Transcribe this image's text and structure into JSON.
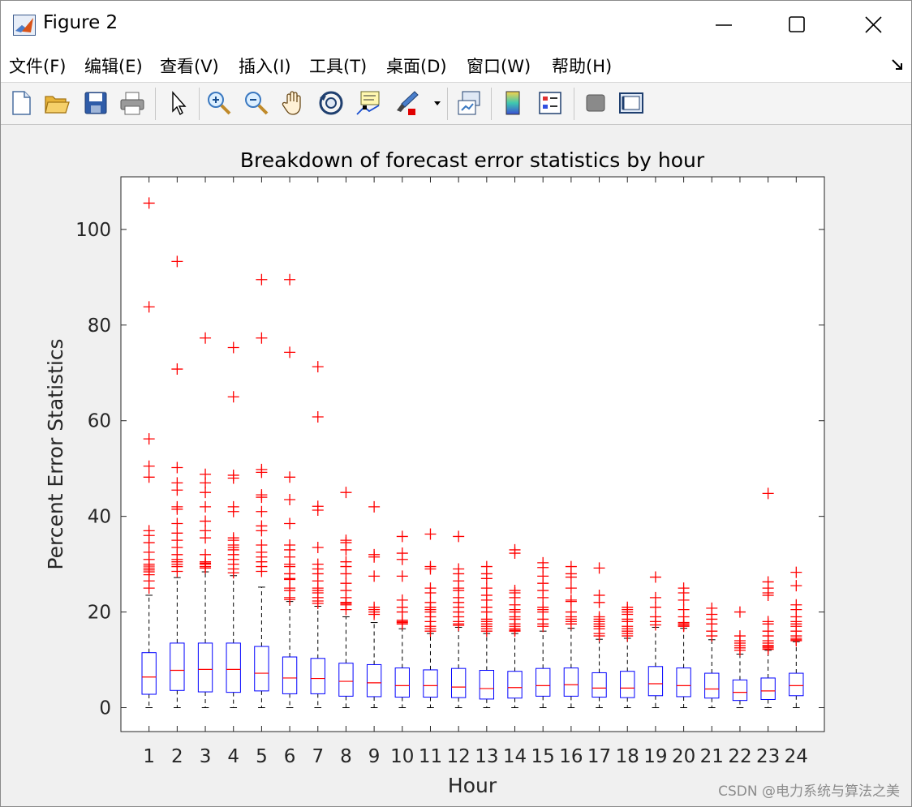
{
  "window": {
    "title": "Figure 2"
  },
  "menu": [
    {
      "label": "文件(F)",
      "key": "F"
    },
    {
      "label": "编辑(E)",
      "key": "E"
    },
    {
      "label": "查看(V)",
      "key": "V"
    },
    {
      "label": "插入(I)",
      "key": "I"
    },
    {
      "label": "工具(T)",
      "key": "T"
    },
    {
      "label": "桌面(D)",
      "key": "D"
    },
    {
      "label": "窗口(W)",
      "key": "W"
    },
    {
      "label": "帮助(H)",
      "key": "H"
    }
  ],
  "toolbar": [
    "new-figure-icon",
    "open-file-icon",
    "save-icon",
    "print-icon",
    "select-arrow-icon",
    "zoom-in-icon",
    "zoom-out-icon",
    "pan-hand-icon",
    "rotate-3d-icon",
    "data-cursor-icon",
    "brush-icon",
    "link-plot-icon",
    "colorbar-icon",
    "legend-icon",
    "hide-plot-tools-icon",
    "show-plot-tools-icon"
  ],
  "watermark": "CSDN @电力系统与算法之美",
  "colors": {
    "box": "#0000ff",
    "median": "#ff0000",
    "outlier": "#ff0000",
    "whisker": "#000000"
  },
  "chart_data": {
    "type": "boxplot",
    "title": "Breakdown of forecast error statistics by hour",
    "xlabel": "Hour",
    "ylabel": "Percent Error Statistics",
    "categories": [
      "1",
      "2",
      "3",
      "4",
      "5",
      "6",
      "7",
      "8",
      "9",
      "10",
      "11",
      "12",
      "13",
      "14",
      "15",
      "16",
      "17",
      "18",
      "19",
      "20",
      "21",
      "22",
      "23",
      "24"
    ],
    "ylim": [
      -5,
      111
    ],
    "yticks": [
      0,
      20,
      40,
      60,
      80,
      100
    ],
    "grid": false,
    "boxes": [
      {
        "q1": 2.8,
        "median": 6.4,
        "q3": 11.5,
        "whisker_low": 0,
        "whisker_high": 23.5,
        "outliers": [
          105.5,
          83.8,
          56.2,
          50.5,
          48.2,
          37,
          36,
          34.5,
          32.5,
          31,
          30,
          29.6,
          29.2,
          28.8,
          28.4,
          27.8,
          26.5,
          25
        ]
      },
      {
        "q1": 3.6,
        "median": 7.8,
        "q3": 13.5,
        "whisker_low": 0,
        "whisker_high": 27.2,
        "outliers": [
          93.3,
          70.8,
          50.2,
          47,
          45.5,
          42,
          41.5,
          38.5,
          36.5,
          35,
          33.5,
          32,
          31,
          30.5,
          30,
          29.5,
          28.5
        ]
      },
      {
        "q1": 3.3,
        "median": 8,
        "q3": 13.5,
        "whisker_low": 0,
        "whisker_high": 28.4,
        "outliers": [
          77.3,
          48.8,
          47,
          45,
          42,
          39,
          37,
          35.5,
          32,
          30.5,
          30.2,
          30,
          29.5,
          29.2
        ]
      },
      {
        "q1": 3.2,
        "median": 8,
        "q3": 13.5,
        "whisker_low": 0,
        "whisker_high": 27.6,
        "outliers": [
          75.3,
          65,
          48.6,
          48,
          42,
          41,
          35.5,
          35,
          34,
          33.5,
          33,
          32,
          31,
          30,
          29,
          28.2
        ]
      },
      {
        "q1": 3.5,
        "median": 7.2,
        "q3": 12.8,
        "whisker_low": 0,
        "whisker_high": 25.2,
        "outliers": [
          89.5,
          77.3,
          49.8,
          49.2,
          44.5,
          44,
          41,
          38,
          37,
          34,
          32.5,
          31.5,
          30.5,
          29.5,
          28.5
        ]
      },
      {
        "q1": 2.9,
        "median": 6.2,
        "q3": 10.6,
        "whisker_low": 0,
        "whisker_high": 22.2,
        "outliers": [
          89.5,
          74.3,
          48.2,
          43.5,
          38.5,
          34,
          33,
          31.5,
          30,
          29.5,
          28,
          27,
          26.8,
          25,
          24.5,
          23,
          22.6
        ]
      },
      {
        "q1": 2.9,
        "median": 6.1,
        "q3": 10.3,
        "whisker_low": 0,
        "whisker_high": 21.2,
        "outliers": [
          71.3,
          60.8,
          42.1,
          41.3,
          33.5,
          30,
          29,
          28,
          26.5,
          25,
          24.5,
          24,
          23,
          22.3,
          21.8
        ]
      },
      {
        "q1": 2.4,
        "median": 5.5,
        "q3": 9.3,
        "whisker_low": 0,
        "whisker_high": 19,
        "outliers": [
          45,
          35,
          34.5,
          33,
          30.5,
          29.5,
          28,
          26,
          24.5,
          23,
          22,
          21.8,
          21.5,
          20.5
        ]
      },
      {
        "q1": 2.3,
        "median": 5.2,
        "q3": 9,
        "whisker_low": 0,
        "whisker_high": 17.8,
        "outliers": [
          42,
          32,
          31.5,
          27.5,
          21,
          20.5,
          20,
          19.5
        ]
      },
      {
        "q1": 2.2,
        "median": 4.6,
        "q3": 8.3,
        "whisker_low": 0,
        "whisker_high": 16.5,
        "outliers": [
          35.8,
          32.3,
          31,
          27.5,
          22.5,
          21,
          20,
          18.3,
          18,
          17.8,
          17.5
        ]
      },
      {
        "q1": 2.2,
        "median": 4.6,
        "q3": 7.9,
        "whisker_low": 0,
        "whisker_high": 15.5,
        "outliers": [
          36.3,
          29.5,
          29,
          25,
          24,
          22,
          21,
          20.5,
          20,
          19,
          18,
          17,
          16.5,
          16
        ]
      },
      {
        "q1": 2.1,
        "median": 4.3,
        "q3": 8.2,
        "whisker_low": 0,
        "whisker_high": 16.8,
        "outliers": [
          35.8,
          29,
          28,
          26.5,
          25,
          24.5,
          23,
          22,
          21,
          20,
          19,
          18,
          17.5,
          17.2
        ]
      },
      {
        "q1": 1.8,
        "median": 4,
        "q3": 7.8,
        "whisker_low": 0,
        "whisker_high": 15.5,
        "outliers": [
          29.5,
          28,
          27,
          25,
          23.5,
          22.5,
          21,
          20,
          18.5,
          18,
          17.5,
          17,
          16.5,
          16
        ]
      },
      {
        "q1": 2,
        "median": 4.2,
        "q3": 7.6,
        "whisker_low": 0,
        "whisker_high": 15.5,
        "outliers": [
          33,
          32.3,
          24.5,
          24,
          23,
          21.5,
          20.5,
          20,
          19,
          18.5,
          17.5,
          17,
          16.5,
          16.2,
          16
        ]
      },
      {
        "q1": 2.4,
        "median": 4.6,
        "q3": 8.2,
        "whisker_low": 0,
        "whisker_high": 16,
        "outliers": [
          30.3,
          29.3,
          27.5,
          26,
          24.5,
          23,
          21,
          20.5,
          20,
          18.5,
          17.5,
          17
        ]
      },
      {
        "q1": 2.4,
        "median": 4.8,
        "q3": 8.3,
        "whisker_low": 0,
        "whisker_high": 16.6,
        "outliers": [
          29.5,
          28,
          27.3,
          25,
          22.5,
          22.2,
          20,
          19,
          18.5,
          18,
          17.5
        ]
      },
      {
        "q1": 2.2,
        "median": 4.1,
        "q3": 7.3,
        "whisker_low": 0,
        "whisker_high": 14.3,
        "outliers": [
          29.2,
          23.5,
          22,
          19,
          18.5,
          18,
          17.5,
          17,
          16.5,
          15.5,
          15
        ]
      },
      {
        "q1": 2.1,
        "median": 4.1,
        "q3": 7.6,
        "whisker_low": 0,
        "whisker_high": 14.5,
        "outliers": [
          21,
          20.5,
          20,
          19.5,
          18.5,
          18,
          17,
          16.5,
          16,
          15.5,
          15
        ]
      },
      {
        "q1": 2.5,
        "median": 5,
        "q3": 8.6,
        "whisker_low": 0,
        "whisker_high": 16.8,
        "outliers": [
          27.3,
          23,
          21,
          19,
          18,
          17.3
        ]
      },
      {
        "q1": 2.3,
        "median": 4.6,
        "q3": 8.3,
        "whisker_low": 0,
        "whisker_high": 16.6,
        "outliers": [
          25,
          24,
          22.5,
          20.5,
          19,
          17.8,
          17.5,
          17.2,
          17
        ]
      },
      {
        "q1": 2,
        "median": 3.9,
        "q3": 7.2,
        "whisker_low": 0,
        "whisker_high": 14.2,
        "outliers": [
          20.8,
          19.5,
          18.5,
          17.5,
          16,
          15
        ]
      },
      {
        "q1": 1.5,
        "median": 3.2,
        "q3": 5.8,
        "whisker_low": 0,
        "whisker_high": 11.2,
        "outliers": [
          20,
          15,
          14,
          13.5,
          13,
          12.5,
          12
        ]
      },
      {
        "q1": 1.7,
        "median": 3.5,
        "q3": 6.2,
        "whisker_low": 0,
        "whisker_high": 12,
        "outliers": [
          44.8,
          26.3,
          25,
          24,
          23.5,
          18,
          17.5,
          16,
          15,
          14,
          13.5,
          13,
          12.8,
          12.5,
          12.2
        ]
      },
      {
        "q1": 2.5,
        "median": 4.6,
        "q3": 7.2,
        "whisker_low": 0,
        "whisker_high": 13.8,
        "outliers": [
          28.3,
          25.5,
          21.5,
          20.5,
          19,
          18,
          17.5,
          17,
          16,
          15,
          14.5,
          14.2,
          14
        ]
      }
    ]
  }
}
